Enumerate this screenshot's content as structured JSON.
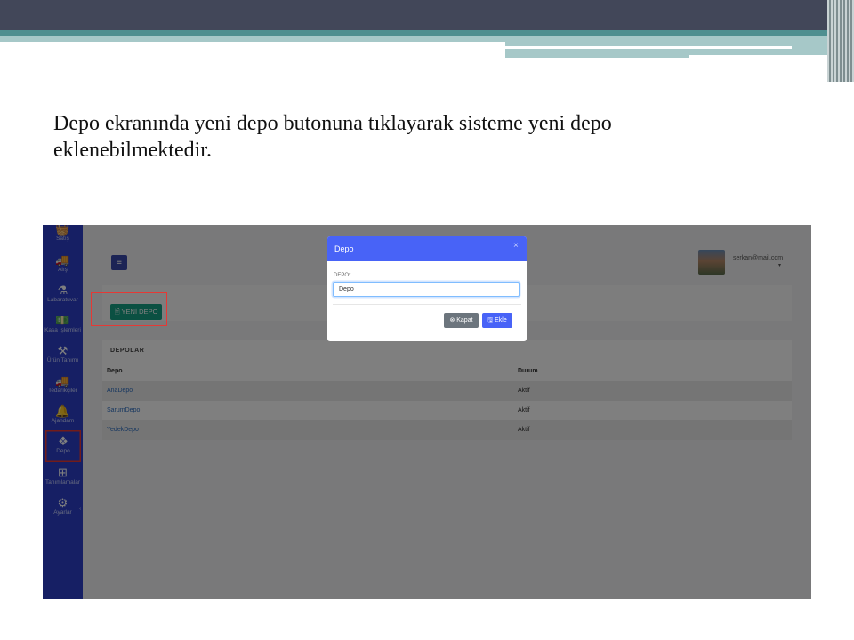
{
  "slide": {
    "text": "Depo ekranında yeni depo butonuna tıklayarak sisteme yeni depo eklenebilmektedir."
  },
  "sidebar": {
    "items": [
      {
        "label": "Satış",
        "icon": "basket-icon",
        "glyph": "🧺"
      },
      {
        "label": "Alış",
        "icon": "truck-icon",
        "glyph": "🚚"
      },
      {
        "label": "Labaratuvar",
        "icon": "flask-icon",
        "glyph": "⚗"
      },
      {
        "label": "Kasa İşlemleri",
        "icon": "money-icon",
        "glyph": "💵"
      },
      {
        "label": "Ürün Tanımı",
        "icon": "people-carry-icon",
        "glyph": "⚒"
      },
      {
        "label": "Tedarikçiler",
        "icon": "truck-icon",
        "glyph": "🚚"
      },
      {
        "label": "Ajandam",
        "icon": "bell-icon",
        "glyph": "🔔"
      },
      {
        "label": "Depo",
        "icon": "dropbox-icon",
        "glyph": "❖"
      },
      {
        "label": "Tanımlamalar",
        "icon": "plus-square-icon",
        "glyph": "⊞"
      },
      {
        "label": "Ayarlar",
        "icon": "gear-icon",
        "glyph": "⚙"
      }
    ]
  },
  "header": {
    "menu_icon": "≡",
    "user_email": "serkan@mail.com",
    "avatar_icon": "user-avatar"
  },
  "actions": {
    "new_depot_label": "🗎 YENİ DEPO"
  },
  "table": {
    "title": "DEPOLAR",
    "columns": [
      "Depo",
      "Durum"
    ],
    "rows": [
      {
        "depo": "AnaDepo",
        "durum": "Aktif"
      },
      {
        "depo": "SarumDepo",
        "durum": "Aktif"
      },
      {
        "depo": "YedekDepo",
        "durum": "Aktif"
      }
    ]
  },
  "modal": {
    "title": "Depo",
    "close_glyph": "×",
    "field_label": "DEPO*",
    "field_value": "Depo",
    "cancel_label": "⊗ Kapat",
    "submit_label": "🖫 Ekle"
  },
  "colors": {
    "sidebar": "#2c3fc9",
    "modal_header": "#4863f7",
    "new_button": "#16a085",
    "highlight": "#e53935"
  }
}
